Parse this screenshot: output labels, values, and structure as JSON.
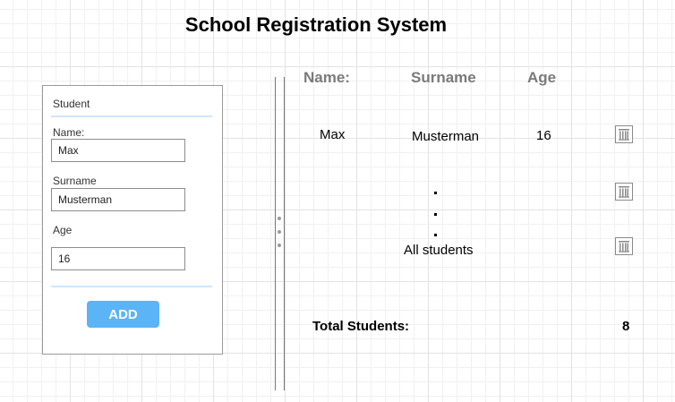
{
  "app": {
    "title": "School Registration System"
  },
  "form": {
    "header": "Student",
    "name_label": "Name:",
    "name_value": "Max",
    "surname_label": "Surname",
    "surname_value": "Musterman",
    "age_label": "Age",
    "age_value": "16",
    "add_label": "ADD"
  },
  "table": {
    "headers": {
      "name": "Name:",
      "surname": "Surname",
      "age": "Age"
    },
    "rows": [
      {
        "name": "Max",
        "surname": "Musterman",
        "age": "16"
      }
    ],
    "placeholder": "All students",
    "total_label": "Total Students:",
    "total_value": "8"
  },
  "colors": {
    "accent": "#5ab4f5",
    "separator": "#cfe6fb",
    "header_text": "#7a7a7a"
  },
  "icons": [
    "trash-icon",
    "drag-handle-icon"
  ]
}
